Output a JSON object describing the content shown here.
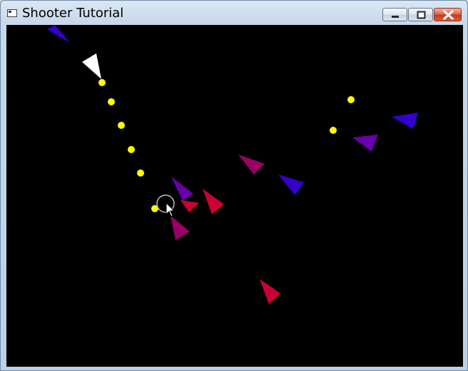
{
  "window": {
    "title": "Shooter Tutorial",
    "icon": "app-window-icon",
    "controls": {
      "minimize": "minimize-icon",
      "maximize": "maximize-icon",
      "close": "close-icon"
    }
  },
  "game": {
    "background_color": "#000000",
    "player": {
      "color": "#ffffff",
      "shape": "triangle"
    },
    "bullet_color": "#ffff00",
    "enemy_colors": [
      "#3300cc",
      "#6600aa",
      "#990066",
      "#cc0033"
    ],
    "cursor": "arrow-pointer-with-crosshair-ring"
  }
}
